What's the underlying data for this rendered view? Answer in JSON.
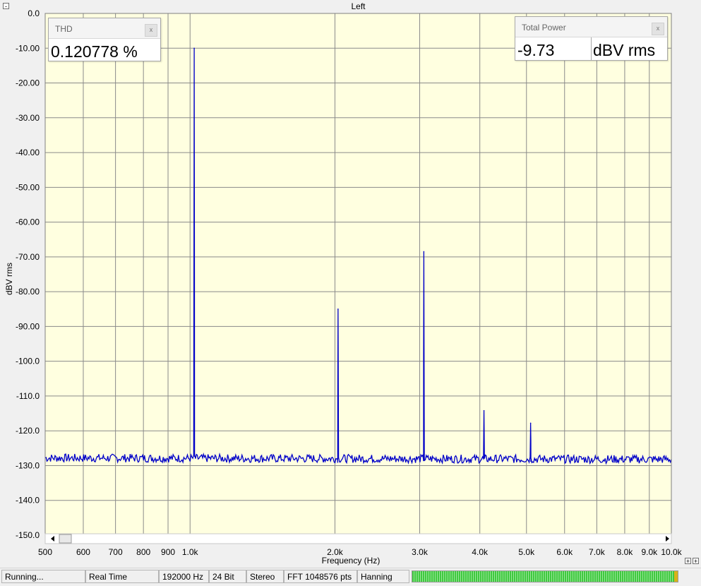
{
  "chart_data": {
    "type": "line",
    "title": "Left",
    "xlabel": "Frequency (Hz)",
    "ylabel": "dBV rms",
    "xscale": "log",
    "xlim": [
      500,
      10000
    ],
    "ylim": [
      -150,
      0
    ],
    "grid": true,
    "background": "#ffffe0",
    "line_color": "#0000c8",
    "x_ticks": [
      500,
      600,
      700,
      800,
      900,
      1000,
      2000,
      3000,
      4000,
      5000,
      6000,
      7000,
      8000,
      9000,
      10000
    ],
    "x_tick_labels": [
      "500",
      "600",
      "700",
      "800",
      "900",
      "1.0k",
      "2.0k",
      "3.0k",
      "4.0k",
      "5.0k",
      "6.0k",
      "7.0k",
      "8.0k",
      "9.0k",
      "10.0k"
    ],
    "y_ticks": [
      0,
      -10,
      -20,
      -30,
      -40,
      -50,
      -60,
      -70,
      -80,
      -90,
      -100,
      -110,
      -120,
      -130,
      -140,
      -150
    ],
    "y_tick_labels": [
      "0.0",
      "-10.00",
      "-20.00",
      "-30.00",
      "-40.00",
      "-50.00",
      "-60.00",
      "-70.00",
      "-80.00",
      "-90.00",
      "-100.0",
      "-110.0",
      "-120.0",
      "-130.0",
      "-140.0",
      "-150.0"
    ],
    "noise_floor_db": -127.8,
    "peaks": [
      {
        "freq": 1020,
        "db": -10.0,
        "base": -127.0
      },
      {
        "freq": 2030,
        "db": -85.0,
        "base": -128.0
      },
      {
        "freq": 3060,
        "db": -68.5,
        "base": -128.0
      },
      {
        "freq": 4080,
        "db": -114.2,
        "base": -128.0
      },
      {
        "freq": 5100,
        "db": -117.8,
        "base": -128.0
      }
    ]
  },
  "thd_widget": {
    "title": "THD",
    "value": "0.120778 %"
  },
  "power_widget": {
    "title": "Total Power",
    "value": "-9.73",
    "unit": "dBV rms"
  },
  "statusbar": {
    "state": "Running...",
    "mode": "Real Time",
    "sample_rate": "192000 Hz",
    "bit_depth": "24 Bit",
    "channels": "Stereo",
    "fft": "FFT 1048576 pts",
    "window": "Hanning"
  },
  "controls": {
    "collapse": "-",
    "close": "x",
    "zoom_in": "+",
    "zoom_out": "+"
  }
}
